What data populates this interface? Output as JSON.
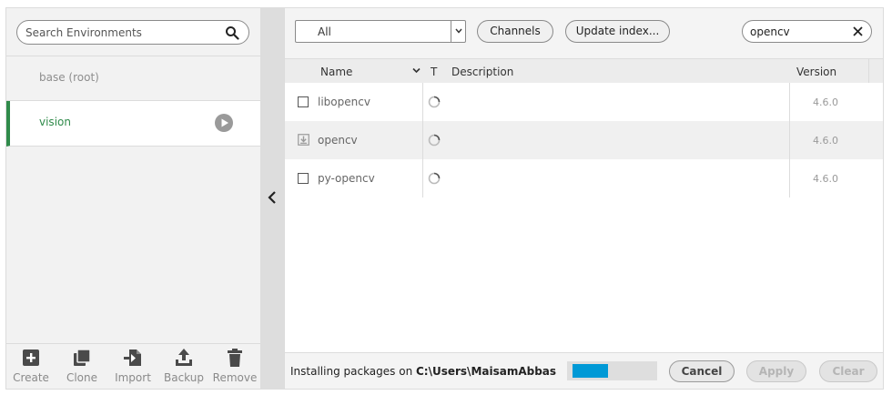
{
  "environments": {
    "search_placeholder": "Search Environments",
    "items": [
      {
        "label": "base (root)",
        "active": false
      },
      {
        "label": "vision",
        "active": true
      }
    ],
    "toolbar": [
      {
        "label": "Create",
        "icon": "plus-icon"
      },
      {
        "label": "Clone",
        "icon": "clone-icon"
      },
      {
        "label": "Import",
        "icon": "import-icon"
      },
      {
        "label": "Backup",
        "icon": "upload-icon"
      },
      {
        "label": "Remove",
        "icon": "trash-icon"
      }
    ]
  },
  "packages": {
    "filter_value": "All",
    "channels_label": "Channels",
    "update_index_label": "Update index...",
    "search_value": "opencv",
    "columns": {
      "name": "Name",
      "type": "T",
      "description": "Description",
      "version": "Version"
    },
    "rows": [
      {
        "name": "libopencv",
        "version": "4.6.0",
        "installed": false
      },
      {
        "name": "opencv",
        "version": "4.6.0",
        "installed": true
      },
      {
        "name": "py-opencv",
        "version": "4.6.0",
        "installed": false
      }
    ]
  },
  "status": {
    "prefix": "Installing packages on ",
    "path": "C:\\Users\\MaisamAbbas\\anac",
    "progress": 0.45,
    "cancel_label": "Cancel",
    "apply_label": "Apply",
    "clear_label": "Clear"
  },
  "colors": {
    "accent_green": "#2f8a4a",
    "progress_blue": "#0099d6"
  }
}
